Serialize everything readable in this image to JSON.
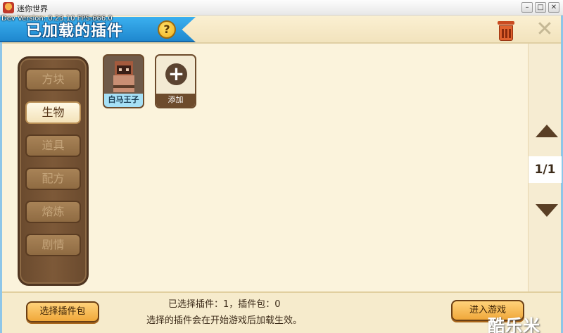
{
  "window": {
    "title": "迷你世界",
    "min_label": "–",
    "max_label": "□",
    "close_label": "✕"
  },
  "debug_text": "Dev Version: 0.23.10 FPS:666.0",
  "header": {
    "title": "已加载的插件",
    "help_label": "?",
    "close_label": "✕"
  },
  "categories": [
    {
      "label": "方块",
      "active": false
    },
    {
      "label": "生物",
      "active": true
    },
    {
      "label": "道具",
      "active": false
    },
    {
      "label": "配方",
      "active": false
    },
    {
      "label": "熔炼",
      "active": false
    },
    {
      "label": "剧情",
      "active": false
    }
  ],
  "plugins": [
    {
      "label": "白马王子"
    }
  ],
  "add_tile": {
    "label": "添加",
    "icon": "+"
  },
  "pager": {
    "page_indicator": "1/1"
  },
  "footer": {
    "select_button": "选择插件包",
    "status_line1": "已选择插件：1，插件包：0",
    "status_line2": "选择的插件会在开始游戏后加载生效。",
    "enter_button": "进入游戏"
  },
  "watermark": "酷乐米",
  "colors": {
    "ribbon_blue": "#2a9be0",
    "panel_cream": "#fbf3dc",
    "wood_brown": "#7d5938",
    "button_orange": "#f0a83a"
  }
}
